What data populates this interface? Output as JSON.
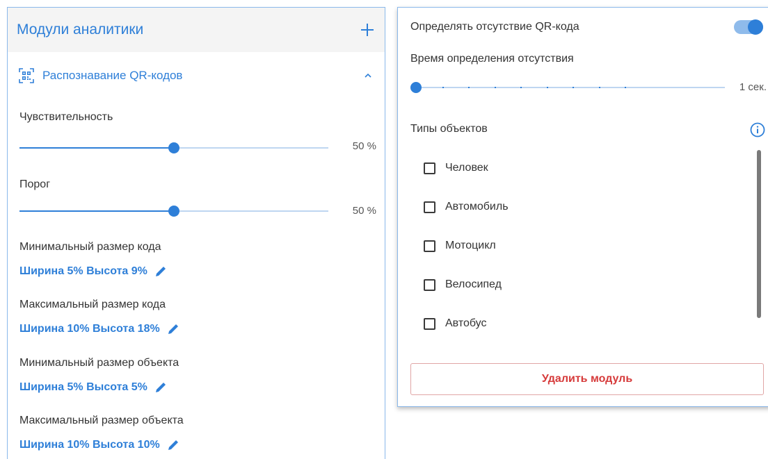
{
  "left": {
    "title": "Модули аналитики",
    "module_name": "Распознавание QR-кодов",
    "sensitivity": {
      "label": "Чувствительность",
      "value": 50,
      "value_text": "50 %"
    },
    "threshold": {
      "label": "Порог",
      "value": 50,
      "value_text": "50 %"
    },
    "min_code": {
      "label": "Минимальный размер кода",
      "value": "Ширина 5% Высота 9%"
    },
    "max_code": {
      "label": "Максимальный размер кода",
      "value": "Ширина 10% Высота 18%"
    },
    "min_object": {
      "label": "Минимальный размер объекта",
      "value": "Ширина 5% Высота 5%"
    },
    "max_object": {
      "label": "Максимальный размер объекта",
      "value": "Ширина 10% Высота 10%"
    }
  },
  "right": {
    "detect_absence": {
      "label": "Определять отсутствие QR-кода",
      "enabled": true
    },
    "absence_time": {
      "label": "Время определения отсутствия",
      "value_text": "1 сек.",
      "value": 0
    },
    "object_types": {
      "label": "Типы объектов",
      "items": [
        {
          "label": "Человек",
          "checked": false
        },
        {
          "label": "Автомобиль",
          "checked": false
        },
        {
          "label": "Мотоцикл",
          "checked": false
        },
        {
          "label": "Велосипед",
          "checked": false
        },
        {
          "label": "Автобус",
          "checked": false
        }
      ]
    },
    "delete_button": "Удалить модуль"
  },
  "colors": {
    "accent": "#2e7fd8",
    "accent_light": "#bed6f1",
    "danger": "#d63a3a",
    "border": "#8ab8ea"
  },
  "icons": [
    "plus-icon",
    "qr-code-icon",
    "chevron-up-icon",
    "pencil-icon",
    "info-icon"
  ]
}
